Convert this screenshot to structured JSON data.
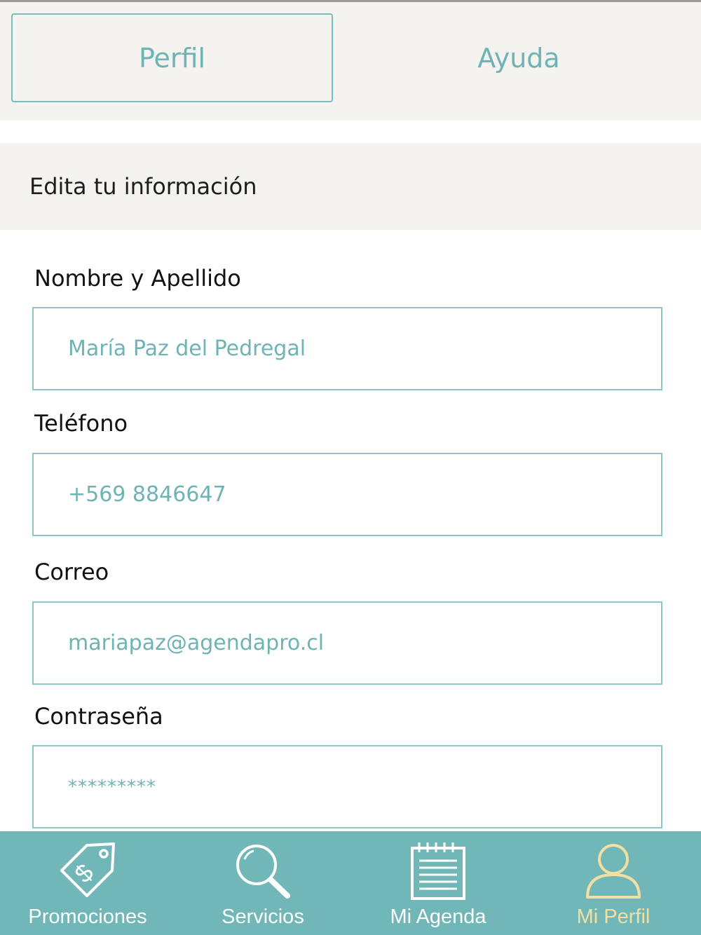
{
  "tabs": {
    "profile_label": "Perfil",
    "help_label": "Ayuda"
  },
  "section": {
    "title": "Edita tu información"
  },
  "form": {
    "fields": [
      {
        "label": "Nombre y Apellido",
        "value": "María Paz del Pedregal"
      },
      {
        "label": "Teléfono",
        "value": "+569 8846647"
      },
      {
        "label": "Correo",
        "value": "mariapaz@agendapro.cl"
      },
      {
        "label": "Contraseña",
        "value": "*********"
      }
    ]
  },
  "bottom_nav": {
    "items": [
      {
        "label": "Promociones",
        "icon": "price-tag-dollar-icon"
      },
      {
        "label": "Servicios",
        "icon": "magnifier-icon"
      },
      {
        "label": "Mi Agenda",
        "icon": "notepad-icon"
      },
      {
        "label": "Mi Perfil",
        "icon": "user-icon",
        "active": true
      }
    ]
  },
  "colors": {
    "accent": "#72b7b7",
    "accent_text": "#6fb3b4",
    "panel_bg": "#f4f3f0",
    "active_nav": "#f1dfa4"
  }
}
